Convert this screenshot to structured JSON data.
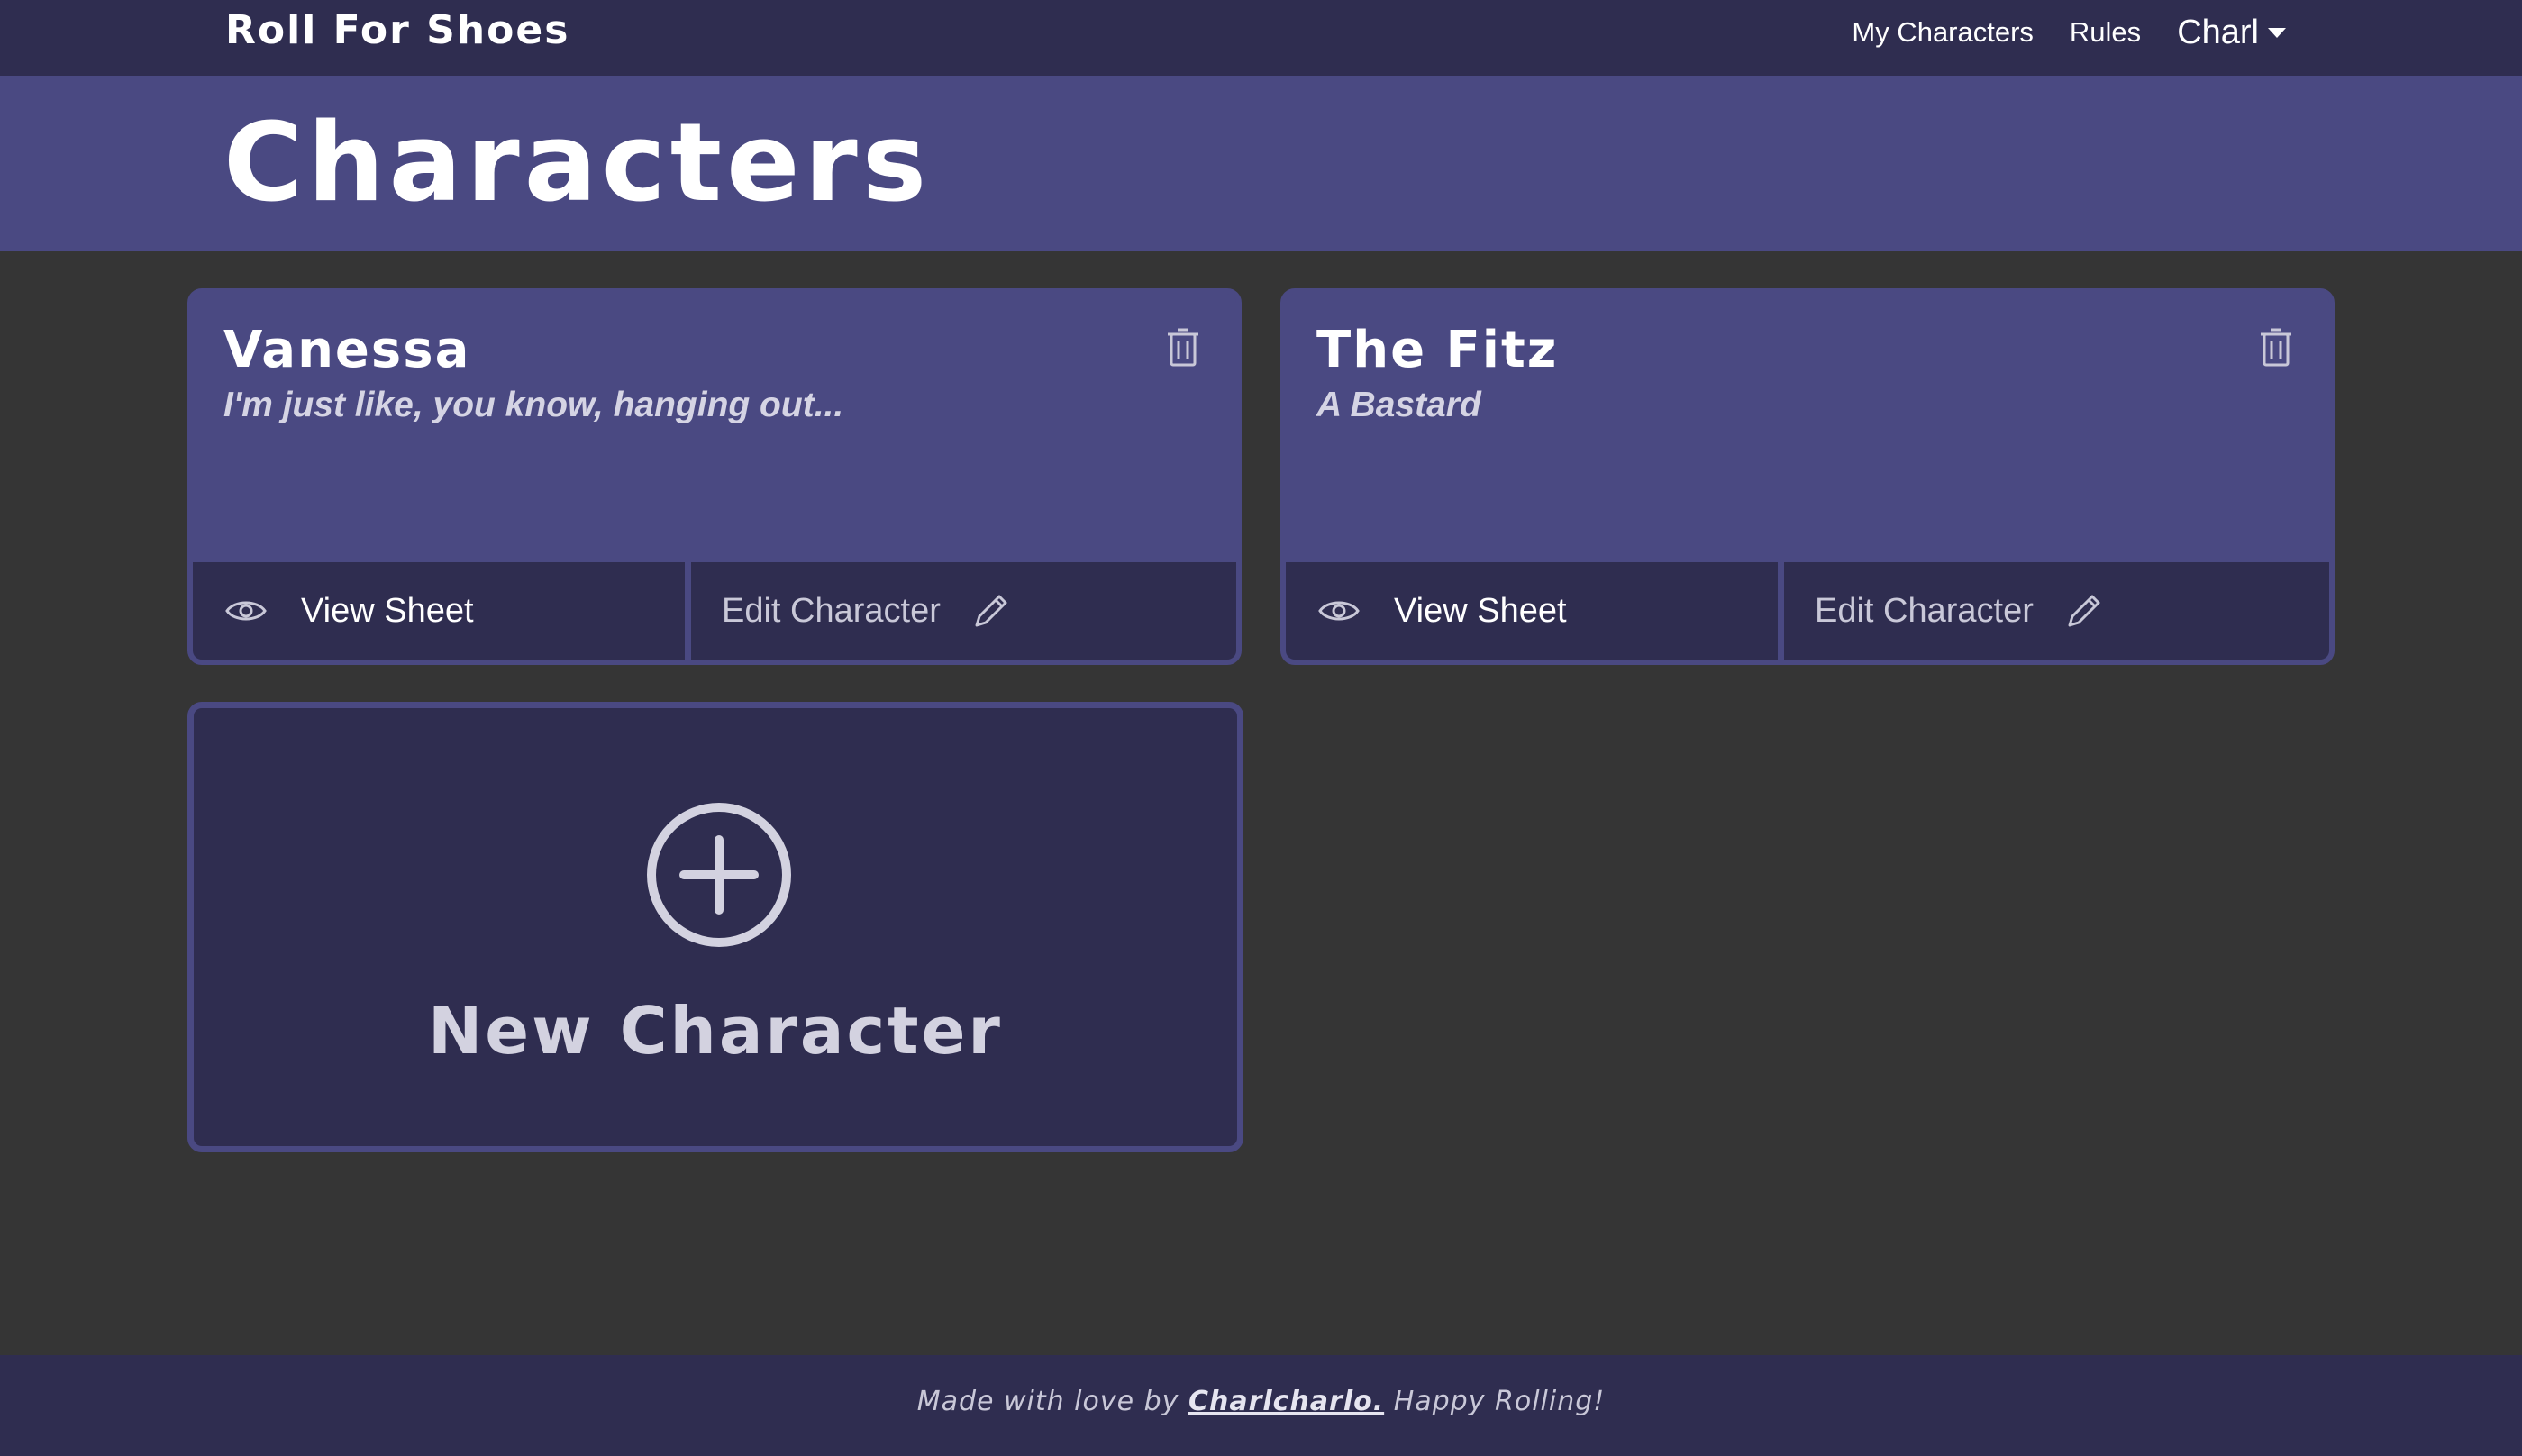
{
  "navbar": {
    "brand": "Roll For Shoes",
    "links": [
      "My Characters",
      "Rules"
    ],
    "user": "Charl"
  },
  "hero": {
    "title": "Characters"
  },
  "characters": [
    {
      "name": "Vanessa",
      "tagline": "I'm just like, you know, hanging out...",
      "view_label": "View Sheet",
      "edit_label": "Edit Character"
    },
    {
      "name": "The Fitz",
      "tagline": "A Bastard",
      "view_label": "View Sheet",
      "edit_label": "Edit Character"
    }
  ],
  "new_character": {
    "label": "New Character"
  },
  "footer": {
    "prefix": "Made with love by",
    "author": "Charlcharlo.",
    "suffix": "Happy Rolling!"
  },
  "colors": {
    "page_background": "#353535",
    "nav_background": "#2f2d50",
    "accent_purple": "#4a4982"
  },
  "icons": {
    "delete": "trash-icon",
    "view": "eye-icon",
    "edit": "pencil-icon",
    "new": "plus-circle-icon",
    "user_menu": "caret-down-icon"
  }
}
